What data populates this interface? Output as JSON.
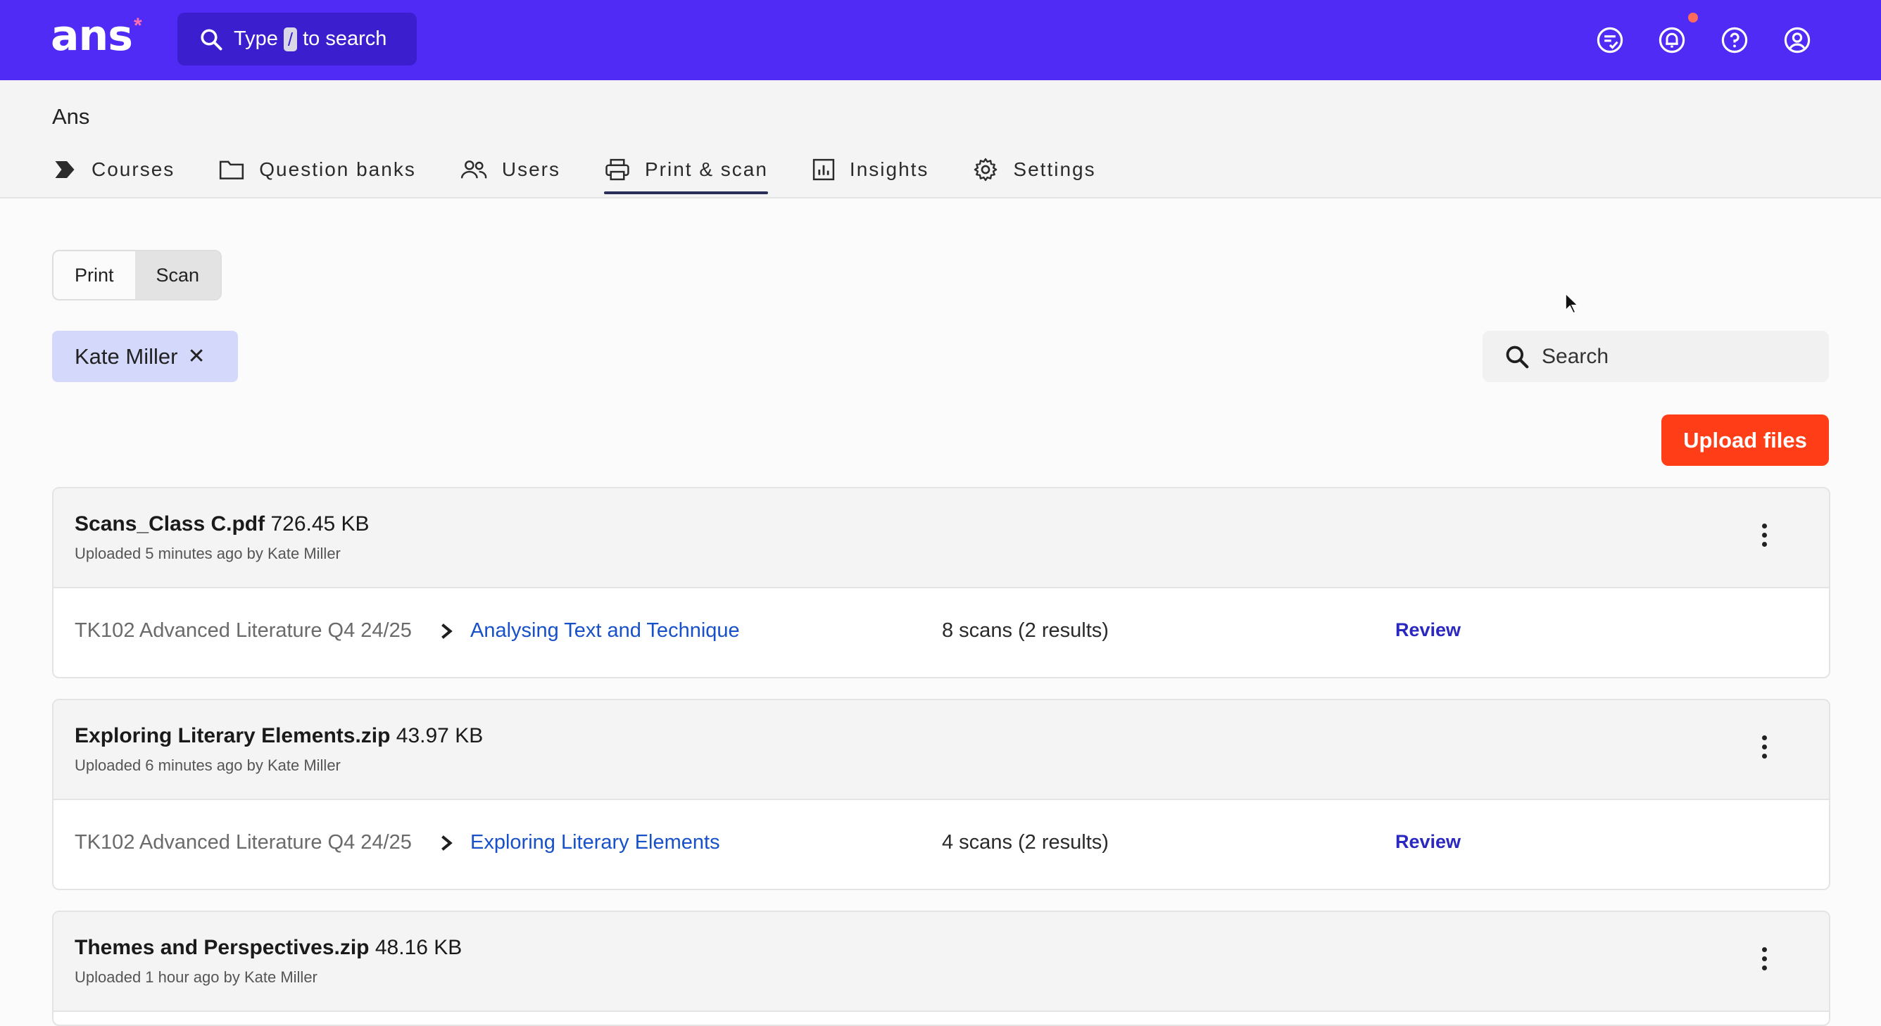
{
  "app": {
    "logo": "ans",
    "logo_mark": "*",
    "search": {
      "prefix": "Type",
      "key": "/",
      "suffix": "to search"
    }
  },
  "header_icons": [
    "feedback-icon",
    "notifications-icon",
    "help-icon",
    "account-icon"
  ],
  "org": {
    "name": "Ans"
  },
  "tabs": [
    {
      "label": "Courses",
      "icon": "courses-icon",
      "active": false
    },
    {
      "label": "Question banks",
      "icon": "folder-icon",
      "active": false
    },
    {
      "label": "Users",
      "icon": "users-icon",
      "active": false
    },
    {
      "label": "Print & scan",
      "icon": "printer-icon",
      "active": true
    },
    {
      "label": "Insights",
      "icon": "chart-icon",
      "active": false
    },
    {
      "label": "Settings",
      "icon": "gear-icon",
      "active": false
    }
  ],
  "mode_toggle": {
    "print": "Print",
    "scan": "Scan",
    "selected": "Scan"
  },
  "filter_chip": {
    "label": "Kate Miller",
    "remove": "✕"
  },
  "search": {
    "placeholder": "Search"
  },
  "upload_button": "Upload files",
  "uploads": [
    {
      "file": "Scans_Class C.pdf",
      "size": "726.45 KB",
      "meta": "Uploaded 5 minutes ago by Kate Miller",
      "course": "TK102 Advanced Literature Q4 24/25",
      "module": "Analysing Text and Technique",
      "scans": "8 scans (2 results)",
      "action": "Review"
    },
    {
      "file": "Exploring Literary Elements.zip",
      "size": "43.97 KB",
      "meta": "Uploaded 6 minutes ago by Kate Miller",
      "course": "TK102 Advanced Literature Q4 24/25",
      "module": "Exploring Literary Elements",
      "scans": "4 scans (2 results)",
      "action": "Review"
    },
    {
      "file": "Themes and Perspectives.zip",
      "size": "48.16 KB",
      "meta": "Uploaded 1 hour ago by Kate Miller"
    }
  ],
  "colors": {
    "brand": "#4f2bf5",
    "accent": "#ff3d17",
    "link": "#1750c8",
    "chip": "#d4d9fb"
  }
}
